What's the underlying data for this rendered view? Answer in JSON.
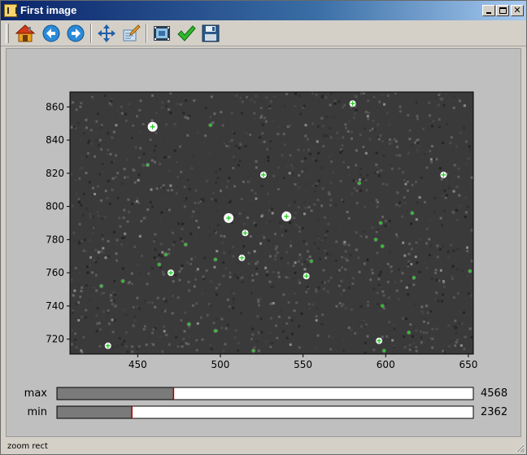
{
  "window": {
    "title": "First image",
    "controls": [
      "minimize",
      "maximize",
      "close"
    ]
  },
  "toolbar": {
    "buttons": [
      {
        "name": "home",
        "icon": "home-icon"
      },
      {
        "name": "back",
        "icon": "arrow-left-icon"
      },
      {
        "name": "forward",
        "icon": "arrow-right-icon"
      },
      {
        "name": "pan",
        "icon": "move-icon"
      },
      {
        "name": "configure",
        "icon": "edit-icon"
      },
      {
        "name": "view",
        "icon": "filmstrip-icon"
      },
      {
        "name": "accept",
        "icon": "checkmark-icon"
      },
      {
        "name": "save",
        "icon": "floppy-disk-icon"
      }
    ]
  },
  "colors": {
    "marker": "#22cc22",
    "plot_bg": "#3a3a3a",
    "canvas_bg": "#bfbfbf",
    "slider_fill": "#7a7a7a",
    "slider_marker": "#aa0000"
  },
  "chart_data": {
    "type": "scatter",
    "x_ticks": [
      450,
      500,
      550,
      600,
      650
    ],
    "y_ticks": [
      720,
      740,
      760,
      780,
      800,
      820,
      840,
      860
    ],
    "xlim": [
      409,
      653
    ],
    "ylim": [
      711,
      869
    ],
    "stars": [
      {
        "x": 459,
        "y": 848,
        "size": 3
      },
      {
        "x": 580,
        "y": 862,
        "size": 2
      },
      {
        "x": 494,
        "y": 849,
        "size": 1
      },
      {
        "x": 456,
        "y": 825,
        "size": 1
      },
      {
        "x": 526,
        "y": 819,
        "size": 2
      },
      {
        "x": 635,
        "y": 819,
        "size": 2
      },
      {
        "x": 584,
        "y": 814,
        "size": 1
      },
      {
        "x": 505,
        "y": 793,
        "size": 3
      },
      {
        "x": 540,
        "y": 794,
        "size": 3
      },
      {
        "x": 597,
        "y": 790,
        "size": 1
      },
      {
        "x": 616,
        "y": 796,
        "size": 1
      },
      {
        "x": 515,
        "y": 784,
        "size": 2
      },
      {
        "x": 594,
        "y": 780,
        "size": 1
      },
      {
        "x": 598,
        "y": 776,
        "size": 1
      },
      {
        "x": 479,
        "y": 777,
        "size": 1
      },
      {
        "x": 467,
        "y": 771,
        "size": 1
      },
      {
        "x": 513,
        "y": 769,
        "size": 2
      },
      {
        "x": 497,
        "y": 768,
        "size": 1
      },
      {
        "x": 555,
        "y": 767,
        "size": 1
      },
      {
        "x": 463,
        "y": 765,
        "size": 1
      },
      {
        "x": 470,
        "y": 760,
        "size": 2
      },
      {
        "x": 552,
        "y": 758,
        "size": 2
      },
      {
        "x": 617,
        "y": 757,
        "size": 1
      },
      {
        "x": 651,
        "y": 761,
        "size": 1
      },
      {
        "x": 441,
        "y": 755,
        "size": 1
      },
      {
        "x": 428,
        "y": 752,
        "size": 1
      },
      {
        "x": 598,
        "y": 740,
        "size": 1
      },
      {
        "x": 481,
        "y": 729,
        "size": 1
      },
      {
        "x": 497,
        "y": 725,
        "size": 1
      },
      {
        "x": 614,
        "y": 724,
        "size": 1
      },
      {
        "x": 596,
        "y": 719,
        "size": 2
      },
      {
        "x": 432,
        "y": 716,
        "size": 2
      },
      {
        "x": 520,
        "y": 713,
        "size": 1
      },
      {
        "x": 599,
        "y": 713,
        "size": 1
      }
    ]
  },
  "sliders": [
    {
      "label": "max",
      "value": "4568",
      "fraction": 0.28
    },
    {
      "label": "min",
      "value": "2362",
      "fraction": 0.18
    }
  ],
  "status": {
    "text": "zoom rect"
  }
}
